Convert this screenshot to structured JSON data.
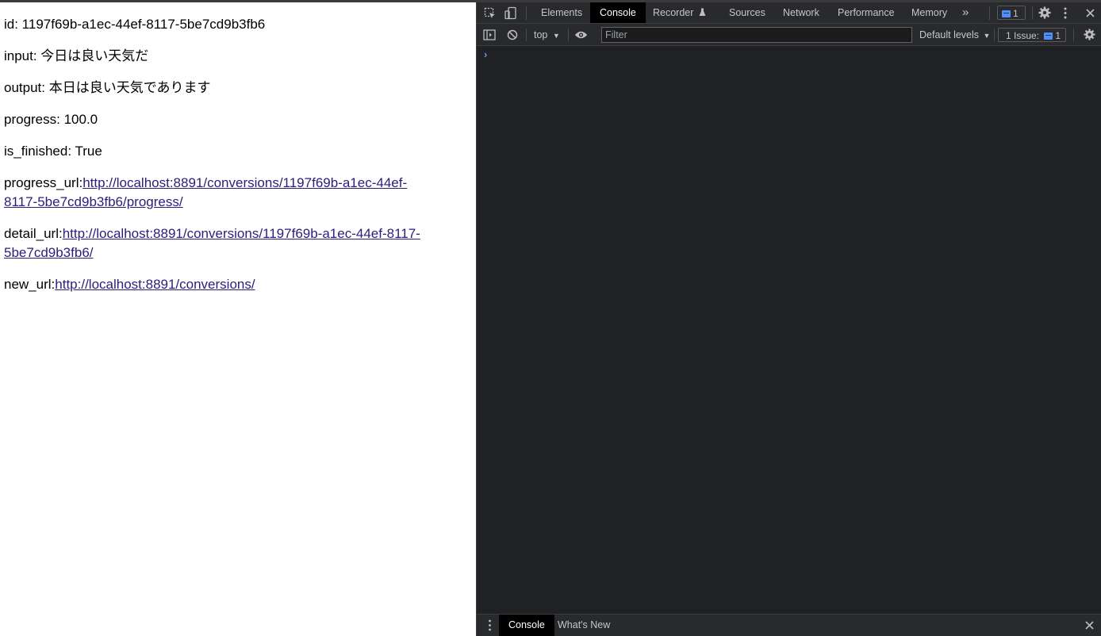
{
  "page": {
    "id_line": "id: 1197f69b-a1ec-44ef-8117-5be7cd9b3fb6",
    "input_line": "input: 今日は良い天気だ",
    "output_line": "output: 本日は良い天気であります",
    "progress_line": "progress: 100.0",
    "finished_line": "is_finished: True",
    "progress_url_label": "progress_url:",
    "progress_url_line1": "http://localhost:8891/conversions/1197f69b-a1ec-44ef-",
    "progress_url_line2": "8117-5be7cd9b3fb6/progress/",
    "detail_url_label": "detail_url:",
    "detail_url_line1": "http://localhost:8891/conversions/1197f69b-a1ec-44ef-8117-",
    "detail_url_line2": "5be7cd9b3fb6/",
    "new_url_label": "new_url:",
    "new_url": "http://localhost:8891/conversions/"
  },
  "devtools": {
    "tabs": {
      "elements": "Elements",
      "console": "Console",
      "recorder": "Recorder",
      "sources": "Sources",
      "network": "Network",
      "performance": "Performance",
      "memory": "Memory"
    },
    "more_tabs_glyph": "»",
    "issues_count": "1",
    "context": "top",
    "filter_placeholder": "Filter",
    "levels": "Default levels",
    "issues_label": "1 Issue:",
    "issues_label_count": "1",
    "prompt_glyph": "›",
    "drawer": {
      "console": "Console",
      "whats_new": "What's New"
    },
    "accent_color": "#4f8ff7"
  }
}
